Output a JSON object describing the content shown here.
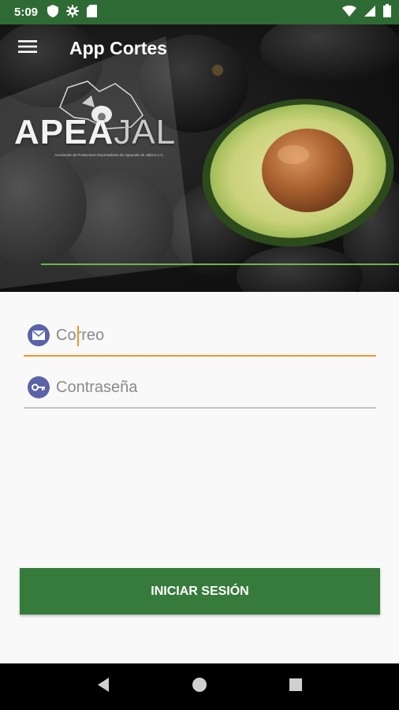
{
  "status_bar": {
    "time": "5:09",
    "left_icons": [
      "shield-icon",
      "gear-icon",
      "sd-card-icon"
    ],
    "right_icons": [
      "wifi-icon",
      "signal-icon",
      "battery-icon"
    ]
  },
  "toolbar": {
    "title": "App Cortes",
    "menu_icon": "hamburger-menu-icon"
  },
  "logo": {
    "main": "APEA",
    "accent": "JAL",
    "subtitle": "Asociación de Productores Exportadores de Aguacate de Jalisco A.C."
  },
  "form": {
    "email": {
      "placeholder": "Correo",
      "value": "",
      "icon": "envelope-icon"
    },
    "password": {
      "placeholder": "Contraseña",
      "value": "",
      "icon": "key-icon"
    }
  },
  "actions": {
    "login_label": "INICIAR SESIÓN"
  },
  "colors": {
    "status_bar": "#2e6b34",
    "primary_button": "#367b3b",
    "focus_underline": "#f0932b",
    "field_icon_bg": "#5a63a8",
    "divider_green": "#6bb64f"
  },
  "nav_bar": [
    "back-icon",
    "home-icon",
    "recents-icon"
  ]
}
